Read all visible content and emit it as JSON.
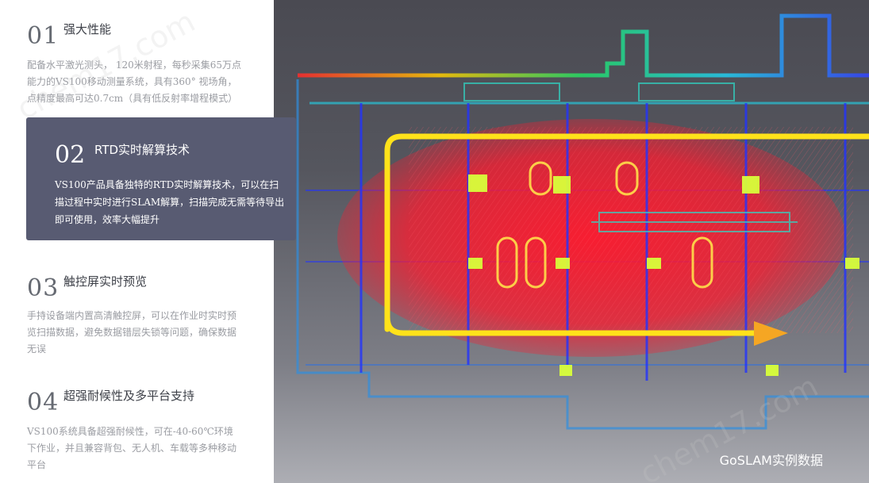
{
  "features": [
    {
      "num": "01",
      "title": "强大性能",
      "desc": "配备水平激光测头， 120米射程，每秒采集65万点能力的VS100移动测量系统，具有360° 视场角，点精度最高可达0.7cm（具有低反射率增程模式）"
    },
    {
      "num": "02",
      "title": "RTD实时解算技术",
      "desc": "VS100产品具备独特的RTD实时解算技术，可以在扫描过程中实时进行SLAM解算，扫描完成无需等待导出即可使用，效率大幅提升"
    },
    {
      "num": "03",
      "title": "触控屏实时预览",
      "desc": "手持设备端内置高清触控屏，可以在作业时实时预览扫描数据，避免数据错层失锁等问题，确保数据无误"
    },
    {
      "num": "04",
      "title": "超强耐候性及多平台支持",
      "desc": "VS100系统具备超强耐候性，可在-40-60℃环境下作业，并且兼容背包、无人机、车载等多种移动平台"
    }
  ],
  "scan": {
    "caption": "GoSLAM实例数据"
  },
  "watermark": {
    "text": "chem17.com"
  },
  "colors": {
    "card_bg": "#585b72",
    "path_yellow": "#ffe21a",
    "arrow_orange": "#f5a623",
    "cloud_red": "#ff1a2e",
    "cloud_blue": "#2233ff"
  }
}
